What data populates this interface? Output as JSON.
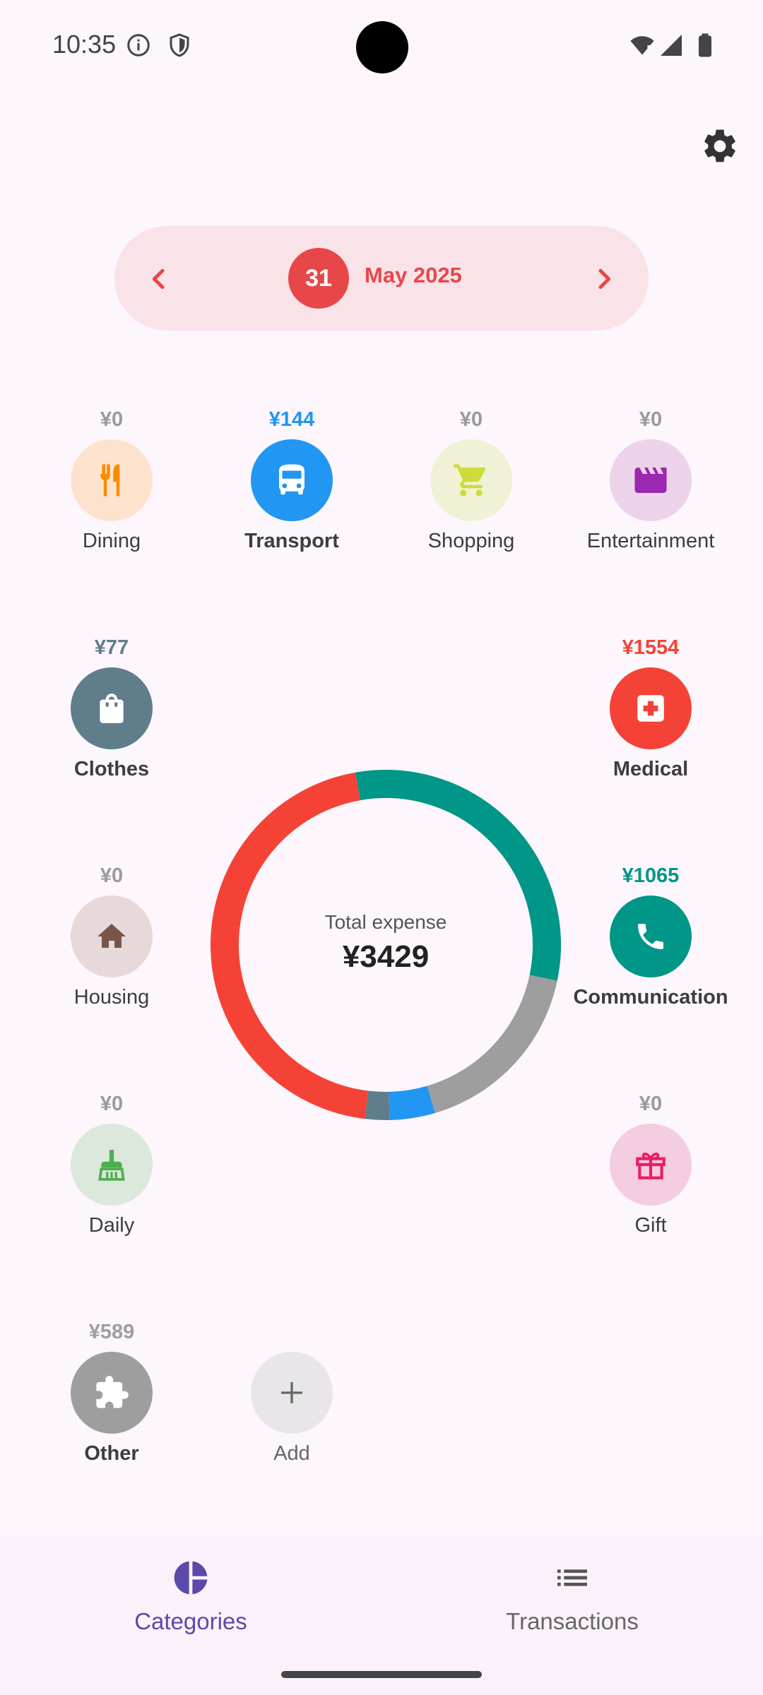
{
  "status_bar": {
    "time": "10:35"
  },
  "date_selector": {
    "day": "31",
    "month": "May 2025"
  },
  "categories": [
    {
      "name": "Dining",
      "amount": "¥0",
      "icon": "fork-knife-icon",
      "color": "#fb8c00",
      "bg": "#fde3cd",
      "amount_color": "#9a9a9a",
      "bold": false
    },
    {
      "name": "Transport",
      "amount": "¥144",
      "icon": "bus-icon",
      "color": "#ffffff",
      "bg": "#2196f3",
      "amount_color": "#2196f3",
      "bold": true
    },
    {
      "name": "Shopping",
      "amount": "¥0",
      "icon": "cart-icon",
      "color": "#cddc39",
      "bg": "#f1f1d5",
      "amount_color": "#9a9a9a",
      "bold": false
    },
    {
      "name": "Entertainment",
      "amount": "¥0",
      "icon": "clapperboard-icon",
      "color": "#9c27b0",
      "bg": "#ecd3ea",
      "amount_color": "#9a9a9a",
      "bold": false
    },
    {
      "name": "Clothes",
      "amount": "¥77",
      "icon": "bag-icon",
      "color": "#ffffff",
      "bg": "#607d8b",
      "amount_color": "#607d8b",
      "bold": true
    },
    {
      "name": "Medical",
      "amount": "¥1554",
      "icon": "first-aid-icon",
      "color": "#ffffff",
      "bg": "#f44336",
      "amount_color": "#f44336",
      "bold": true
    },
    {
      "name": "Housing",
      "amount": "¥0",
      "icon": "house-icon",
      "color": "#795548",
      "bg": "#e7d9d9",
      "amount_color": "#9a9a9a",
      "bold": false
    },
    {
      "name": "Communication",
      "amount": "¥1065",
      "icon": "phone-icon",
      "color": "#ffffff",
      "bg": "#009688",
      "amount_color": "#009688",
      "bold": true
    },
    {
      "name": "Daily",
      "amount": "¥0",
      "icon": "broom-icon",
      "color": "#4caf50",
      "bg": "#dce8dc",
      "amount_color": "#9a9a9a",
      "bold": false
    },
    {
      "name": "Gift",
      "amount": "¥0",
      "icon": "gift-icon",
      "color": "#e91e63",
      "bg": "#f5cde0",
      "amount_color": "#9a9a9a",
      "bold": false
    },
    {
      "name": "Other",
      "amount": "¥589",
      "icon": "puzzle-icon",
      "color": "#ffffff",
      "bg": "#9e9e9e",
      "amount_color": "#9e9e9e",
      "bold": true
    }
  ],
  "add_button": {
    "label": "Add"
  },
  "summary": {
    "label": "Total expense",
    "value": "¥3429"
  },
  "chart_data": {
    "type": "pie",
    "categories": [
      "Communication",
      "Other",
      "Transport",
      "Clothes",
      "Medical"
    ],
    "values": [
      1065,
      589,
      144,
      77,
      1554
    ],
    "colors": [
      "#009688",
      "#9e9e9e",
      "#2196f3",
      "#607d8b",
      "#f44336"
    ]
  },
  "bottom_nav": {
    "categories_label": "Categories",
    "transactions_label": "Transactions",
    "active_color": "#5b4aa8"
  }
}
